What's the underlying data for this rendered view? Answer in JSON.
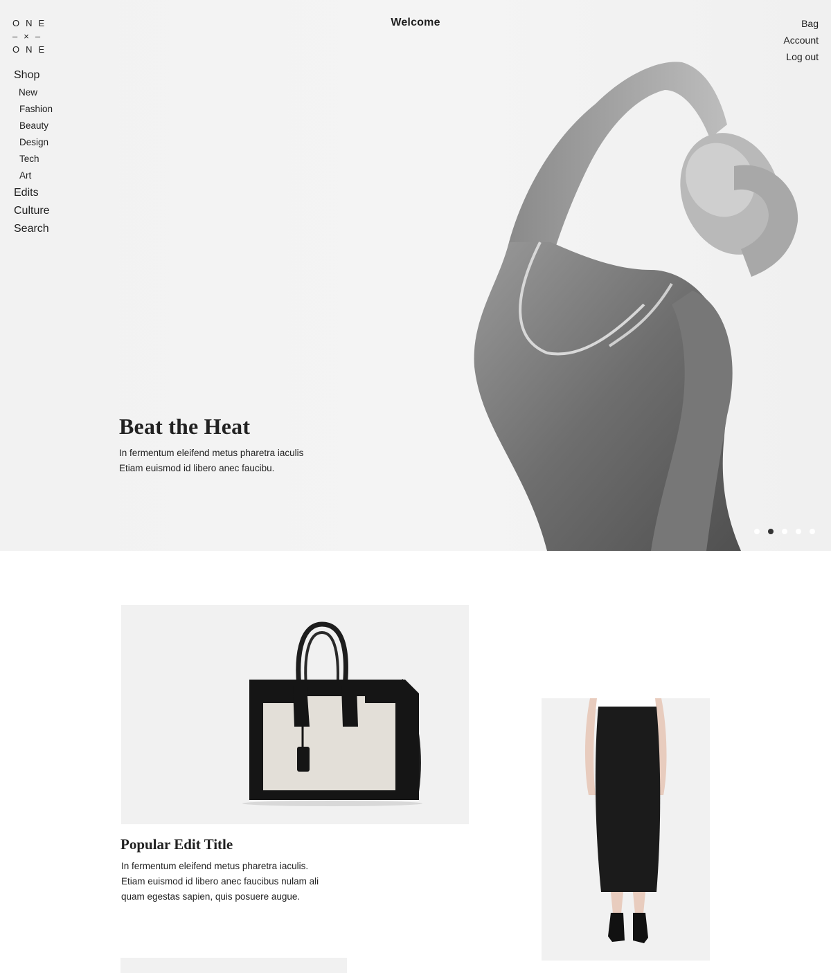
{
  "brand": {
    "logo_lines": [
      "ONE",
      "–×–",
      "ONE"
    ]
  },
  "nav": {
    "shop": "Shop",
    "shop_items": [
      "New",
      "Fashion",
      "Beauty",
      "Design",
      "Tech",
      "Art"
    ],
    "edits": "Edits",
    "culture": "Culture",
    "search": "Search"
  },
  "header": {
    "welcome": "Welcome"
  },
  "account_nav": {
    "bag": "Bag",
    "account": "Account",
    "logout": "Log out"
  },
  "hero": {
    "title": "Beat the Heat",
    "text_line1": "In fermentum eleifend metus pharetra iaculis",
    "text_line2": "Etiam euismod id libero anec faucibu.",
    "slide_count": 5,
    "active_slide": 2
  },
  "edit": {
    "title": "Popular Edit Title",
    "text_line1": "In fermentum eleifend metus pharetra iaculis.",
    "text_line2": "Etiam euismod id libero anec faucibus nulam ali",
    "text_line3": "quam egestas sapien, quis posuere augue."
  },
  "colors": {
    "text": "#1e1e1e",
    "hero_bg": "#f3f3f3",
    "card_bg": "#f1f1f1",
    "dot_active": "#333333",
    "dot_inactive": "#ffffff"
  }
}
